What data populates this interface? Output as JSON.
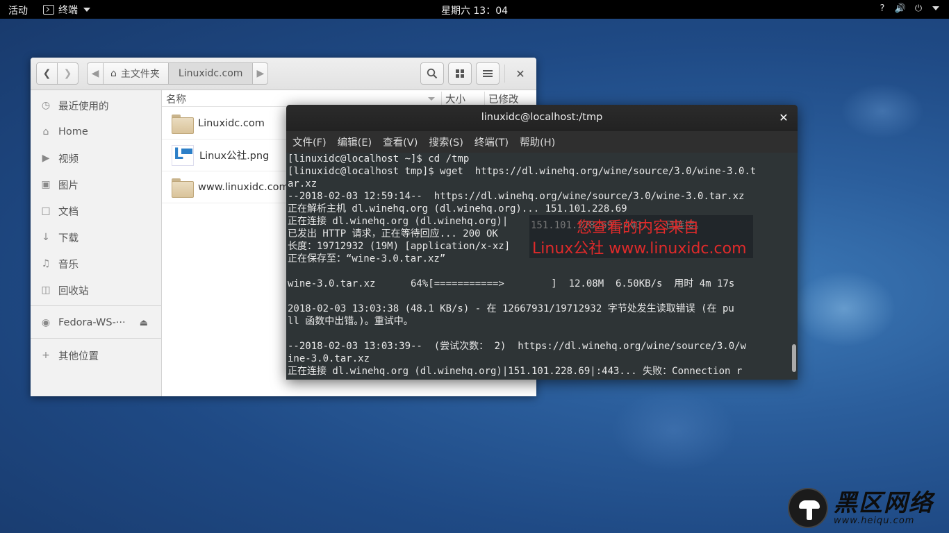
{
  "topbar": {
    "activities": "活动",
    "app_name": "终端",
    "clock": "星期六 13：04",
    "tray_icons": [
      "help-icon",
      "volume-icon",
      "power-icon"
    ]
  },
  "files": {
    "path": {
      "home": "主文件夹",
      "current": "Linuxidc.com"
    },
    "sidebar": [
      {
        "label": "最近使用的",
        "icon": "clock-icon"
      },
      {
        "label": "Home",
        "icon": "home-icon"
      },
      {
        "label": "视频",
        "icon": "video-icon"
      },
      {
        "label": "图片",
        "icon": "camera-icon"
      },
      {
        "label": "文档",
        "icon": "document-icon"
      },
      {
        "label": "下载",
        "icon": "download-icon"
      },
      {
        "label": "音乐",
        "icon": "music-icon"
      },
      {
        "label": "回收站",
        "icon": "trash-icon"
      },
      {
        "label": "Fedora-WS-···",
        "icon": "disc-icon"
      },
      {
        "label": "其他位置",
        "icon": "plus-icon"
      }
    ],
    "columns": {
      "name": "名称",
      "size": "大小",
      "modified": "已修改"
    },
    "rows": [
      {
        "name": "Linuxidc.com",
        "type": "folder"
      },
      {
        "name": "Linux公社.png",
        "type": "image"
      },
      {
        "name": "www.linuxidc.com",
        "type": "folder"
      }
    ]
  },
  "terminal": {
    "title": "linuxidc@localhost:/tmp",
    "menu": [
      "文件(F)",
      "编辑(E)",
      "查看(V)",
      "搜索(S)",
      "终端(T)",
      "帮助(H)"
    ],
    "lines": [
      "[linuxidc@localhost ~]$ cd /tmp",
      "[linuxidc@localhost tmp]$ wget  https://dl.winehq.org/wine/source/3.0/wine-3.0.t",
      "ar.xz",
      "--2018-02-03 12:59:14--  https://dl.winehq.org/wine/source/3.0/wine-3.0.tar.xz",
      "正在解析主机 dl.winehq.org (dl.winehq.org)... 151.101.228.69",
      "正在连接 dl.winehq.org (dl.winehq.org)|",
      "已发出 HTTP 请求，正在等待回应... 200 OK",
      "长度：19712932 (19M) [application/x-xz]",
      "正在保存至：“wine-3.0.tar.xz”",
      "",
      "wine-3.0.tar.xz      64%[===========>        ]  12.08M  6.50KB/s  用时 4m 17s",
      "",
      "2018-02-03 13:03:38 (48.1 KB/s) - 在 12667931/19712932 字节处发生读取错误 (在 pu",
      "ll 函数中出错。)。重试中。",
      "",
      "--2018-02-03 13:03:39--  (尝试次数： 2)  https://dl.winehq.org/wine/source/3.0/w",
      "ine-3.0.tar.xz",
      "正在连接 dl.winehq.org (dl.winehq.org)|151.101.228.69|:443... 失败：Connection r"
    ],
    "overlay_faint": "151.101.228.69|:443... 已连接。",
    "watermark_line1": "您查看的内容来自",
    "watermark_line2": "Linux公社 www.linuxidc.com"
  },
  "site_logo": {
    "big": "黑区网络",
    "small": "www.heiqu.com"
  }
}
